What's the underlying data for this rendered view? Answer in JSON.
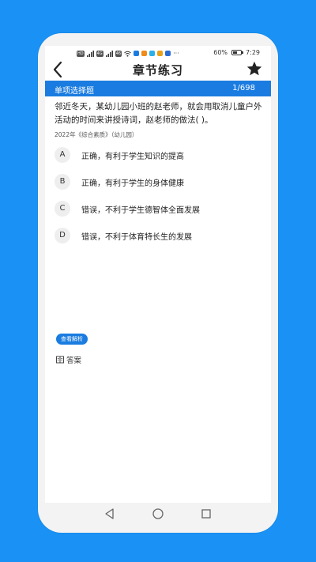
{
  "status_bar": {
    "left_chips": [
      "HD",
      "4G",
      "46"
    ],
    "battery_text": "60%",
    "battery_level": 0.6,
    "time": "7:29",
    "more": "···"
  },
  "header": {
    "title": "章节练习",
    "back_icon": "chevron-left-icon",
    "favorite_icon": "star-icon"
  },
  "section": {
    "title": "单项选择题",
    "progress": "1/698"
  },
  "question": {
    "text": "邻近冬天，某幼儿园小班的赵老师，就会用取消儿童户外活动的时间来讲授诗词，赵老师的做法(  )。",
    "source": "2022年《综合素质》（幼儿园）"
  },
  "options": [
    {
      "letter": "A",
      "text": "正确，有利于学生知识的提高"
    },
    {
      "letter": "B",
      "text": "正确，有利于学生的身体健康"
    },
    {
      "letter": "C",
      "text": "错误，不利于学生德智体全面发展"
    },
    {
      "letter": "D",
      "text": "错误，不利于体育特长生的发展"
    }
  ],
  "analysis_button": "查看解析",
  "answer_label": "答案",
  "colors": {
    "background": "#1a92f5",
    "accent": "#1a7ce0"
  },
  "system_nav": [
    "back-triangle-icon",
    "home-circle-icon",
    "recents-square-icon"
  ]
}
